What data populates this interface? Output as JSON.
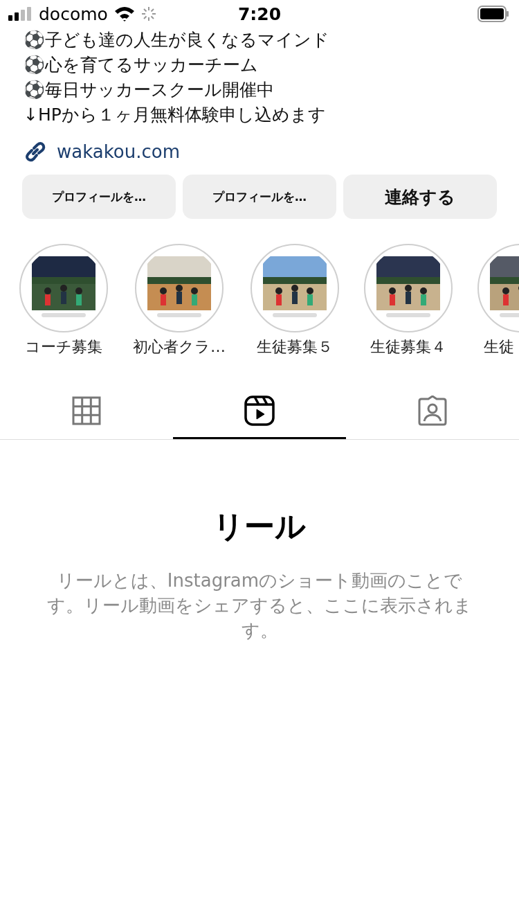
{
  "status_bar": {
    "carrier": "docomo",
    "time": "7:20"
  },
  "bio": {
    "lines": [
      "⚽子ども達の人生が良くなるマインド",
      "⚽心を育てるサッカーチーム",
      "⚽毎日サッカースクール開催中",
      "↓HPから１ヶ月無料体験申し込めます"
    ],
    "link": "wakakou.com"
  },
  "buttons": [
    {
      "label": "プロフィールを…",
      "kind": "small"
    },
    {
      "label": "プロフィールを…",
      "kind": "small"
    },
    {
      "label": "連絡する",
      "kind": "large"
    }
  ],
  "highlights": [
    {
      "label": "コーチ募集",
      "kind": "picture"
    },
    {
      "label": "初心者クラ…",
      "kind": "picture"
    },
    {
      "label": "生徒募集５",
      "kind": "picture"
    },
    {
      "label": "生徒募集４",
      "kind": "picture"
    },
    {
      "label": "生徒",
      "kind": "picture"
    }
  ],
  "tabs": [
    {
      "kind": "grid",
      "selected": false
    },
    {
      "kind": "reels",
      "selected": true
    },
    {
      "kind": "tagged",
      "selected": false
    }
  ],
  "empty_state": {
    "title": "リール",
    "text": "リールとは、Instagramのショート動画のことです。リール動画をシェアすると、ここに表示されます。"
  }
}
